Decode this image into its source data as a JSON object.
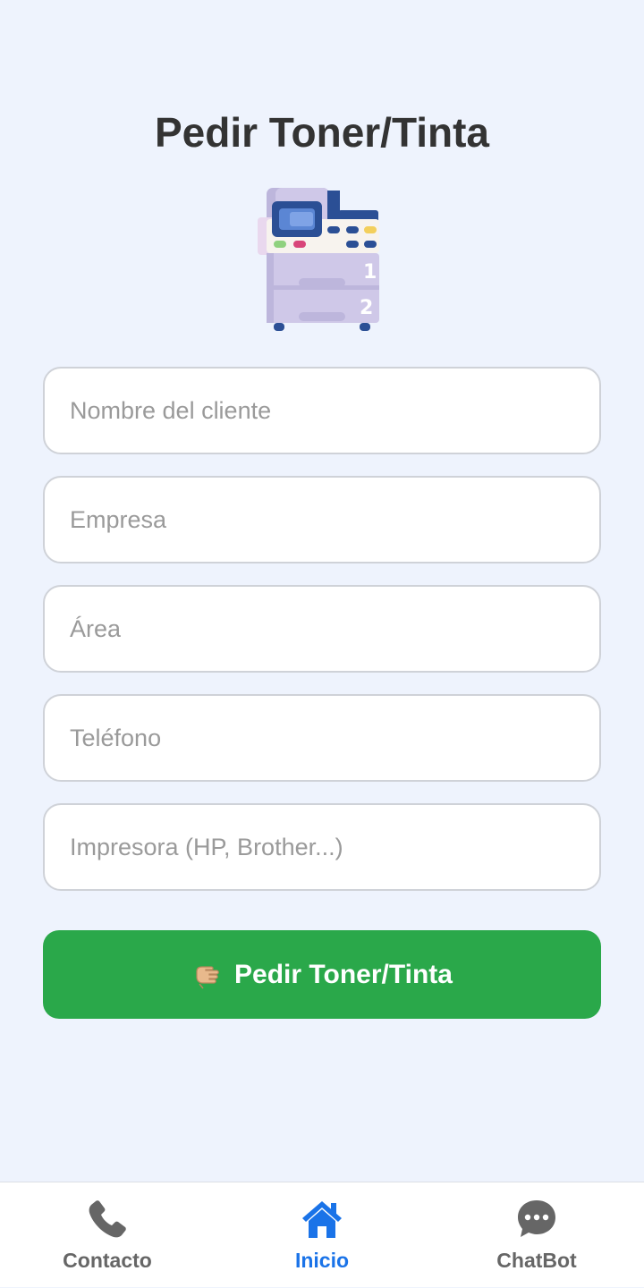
{
  "page": {
    "title": "Pedir Toner/Tinta",
    "hero_icon": "printer-copier-icon"
  },
  "form": {
    "fields": [
      {
        "name": "nombre",
        "placeholder": "Nombre del cliente",
        "value": ""
      },
      {
        "name": "empresa",
        "placeholder": "Empresa",
        "value": ""
      },
      {
        "name": "area",
        "placeholder": "Área",
        "value": ""
      },
      {
        "name": "telefono",
        "placeholder": "Teléfono",
        "value": ""
      },
      {
        "name": "impresora",
        "placeholder": "Impresora (HP, Brother...)",
        "value": ""
      }
    ],
    "submit": {
      "label": "Pedir Toner/Tinta",
      "icon": "hand-pointing-icon",
      "color": "#2aa84a"
    }
  },
  "bottom_nav": {
    "items": [
      {
        "label": "Contacto",
        "icon": "phone-icon",
        "active": false
      },
      {
        "label": "Inicio",
        "icon": "home-icon",
        "active": true
      },
      {
        "label": "ChatBot",
        "icon": "chat-bubble-icon",
        "active": false
      }
    ],
    "active_color": "#1a73e8",
    "inactive_color": "#666666"
  },
  "colors": {
    "background": "#eef3fd",
    "title": "#333333"
  }
}
